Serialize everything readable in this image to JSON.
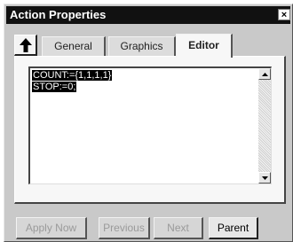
{
  "window": {
    "title": "Action Properties",
    "close_glyph": "×"
  },
  "toolbar": {
    "up_icon": "arrow-up-icon"
  },
  "tabs": [
    {
      "label": "General",
      "active": false
    },
    {
      "label": "Graphics",
      "active": false
    },
    {
      "label": "Editor",
      "active": true
    }
  ],
  "editor": {
    "lines": [
      "COUNT:={1,1,1,1}",
      "STOP:=0;"
    ]
  },
  "buttons": {
    "apply_now": "Apply Now",
    "previous": "Previous",
    "next": "Next",
    "parent": "Parent"
  },
  "colors": {
    "title_bar": "#111111",
    "selection": "#000000",
    "dialog_bg": "#c9c9c9"
  }
}
